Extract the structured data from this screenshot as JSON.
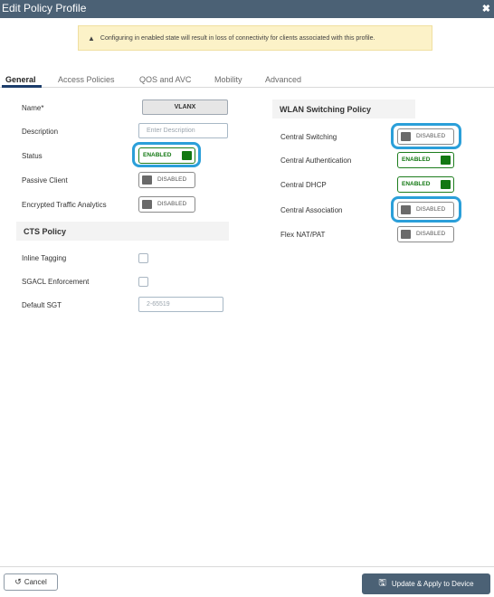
{
  "window": {
    "title": "Edit Policy Profile",
    "close_glyph": "✖"
  },
  "warning": {
    "icon": "warning-triangle-icon",
    "glyph": "▲",
    "text": "Configuring in enabled state will result in loss of connectivity for clients associated with this profile."
  },
  "tabs": [
    {
      "label": "General",
      "active": true
    },
    {
      "label": "Access Policies",
      "active": false
    },
    {
      "label": "QOS and AVC",
      "active": false
    },
    {
      "label": "Mobility",
      "active": false
    },
    {
      "label": "Advanced",
      "active": false
    }
  ],
  "left": {
    "name": {
      "label": "Name*",
      "value": "VLANX"
    },
    "description": {
      "label": "Description",
      "placeholder": "Enter Description"
    },
    "status": {
      "label": "Status",
      "state": "ENABLED"
    },
    "passive_client": {
      "label": "Passive Client",
      "state": "DISABLED"
    },
    "encrypted_traffic": {
      "label": "Encrypted Traffic Analytics",
      "state": "DISABLED"
    },
    "cts": {
      "heading": "CTS Policy",
      "inline_tagging": {
        "label": "Inline Tagging",
        "checked": false
      },
      "sgacl": {
        "label": "SGACL Enforcement",
        "checked": false
      },
      "default_sgt": {
        "label": "Default SGT",
        "placeholder": "2-65519"
      }
    }
  },
  "right": {
    "heading": "WLAN Switching Policy",
    "central_switching": {
      "label": "Central Switching",
      "state": "DISABLED"
    },
    "central_auth": {
      "label": "Central Authentication",
      "state": "ENABLED"
    },
    "central_dhcp": {
      "label": "Central DHCP",
      "state": "ENABLED"
    },
    "central_assoc": {
      "label": "Central Association",
      "state": "DISABLED"
    },
    "flex_nat": {
      "label": "Flex NAT/PAT",
      "state": "DISABLED"
    }
  },
  "footer": {
    "cancel": {
      "label": "Cancel",
      "glyph": "↺"
    },
    "apply": {
      "label": "Update & Apply to Device",
      "glyph": "🖫"
    }
  },
  "colors": {
    "titlebar": "#4b6175",
    "enabled": "#127812",
    "highlight": "#2b9fd9",
    "warning_bg": "#fcf2c8"
  }
}
